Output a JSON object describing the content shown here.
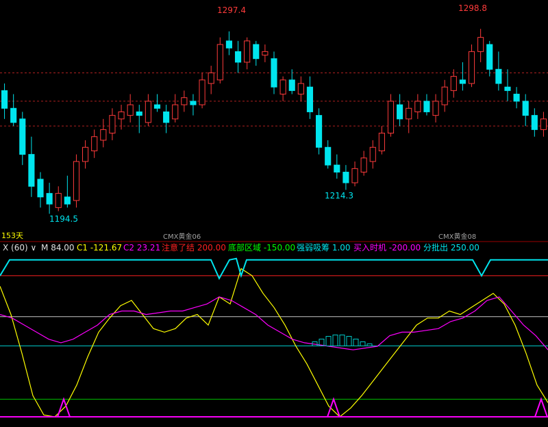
{
  "chart_data": [
    {
      "type": "candlestick",
      "title": "",
      "price_range": [
        1180,
        1312
      ],
      "colors": {
        "up": "#ff3b3b",
        "down": "#00e5ee",
        "dashed_level": "#b02020"
      },
      "dashed_levels": [
        1274,
        1258,
        1244
      ],
      "candles": [
        [
          1264,
          1268,
          1248,
          1254
        ],
        [
          1254,
          1262,
          1244,
          1246
        ],
        [
          1248,
          1252,
          1222,
          1228
        ],
        [
          1228,
          1238,
          1204,
          1210
        ],
        [
          1214,
          1218,
          1198,
          1204
        ],
        [
          1206,
          1212,
          1194.5,
          1200
        ],
        [
          1198,
          1210,
          1196,
          1206
        ],
        [
          1204,
          1216,
          1198,
          1200
        ],
        [
          1202,
          1228,
          1198,
          1224
        ],
        [
          1224,
          1236,
          1220,
          1232
        ],
        [
          1230,
          1242,
          1226,
          1238
        ],
        [
          1236,
          1248,
          1232,
          1242
        ],
        [
          1240,
          1254,
          1236,
          1250
        ],
        [
          1248,
          1256,
          1242,
          1252
        ],
        [
          1250,
          1262,
          1246,
          1256
        ],
        [
          1252,
          1256,
          1240,
          1250
        ],
        [
          1246,
          1262,
          1244,
          1258
        ],
        [
          1256,
          1262,
          1252,
          1254
        ],
        [
          1252,
          1256,
          1240,
          1246
        ],
        [
          1248,
          1262,
          1246,
          1256
        ],
        [
          1256,
          1264,
          1252,
          1260
        ],
        [
          1258,
          1262,
          1250,
          1256
        ],
        [
          1256,
          1274,
          1254,
          1270
        ],
        [
          1268,
          1278,
          1262,
          1274
        ],
        [
          1270,
          1294,
          1268,
          1290
        ],
        [
          1292,
          1297.4,
          1284,
          1288
        ],
        [
          1286,
          1292,
          1274,
          1280
        ],
        [
          1280,
          1294,
          1276,
          1292
        ],
        [
          1290,
          1292,
          1278,
          1282
        ],
        [
          1284,
          1290,
          1280,
          1286
        ],
        [
          1282,
          1286,
          1262,
          1266
        ],
        [
          1262,
          1272,
          1258,
          1270
        ],
        [
          1270,
          1276,
          1262,
          1264
        ],
        [
          1262,
          1272,
          1258,
          1268
        ],
        [
          1266,
          1272,
          1248,
          1252
        ],
        [
          1250,
          1254,
          1228,
          1232
        ],
        [
          1232,
          1236,
          1220,
          1222
        ],
        [
          1222,
          1228,
          1214.3,
          1218
        ],
        [
          1218,
          1222,
          1208,
          1212
        ],
        [
          1212,
          1224,
          1210,
          1220
        ],
        [
          1218,
          1230,
          1216,
          1226
        ],
        [
          1224,
          1236,
          1220,
          1232
        ],
        [
          1230,
          1244,
          1228,
          1240
        ],
        [
          1240,
          1262,
          1238,
          1258
        ],
        [
          1256,
          1262,
          1244,
          1248
        ],
        [
          1248,
          1258,
          1240,
          1254
        ],
        [
          1252,
          1262,
          1248,
          1258
        ],
        [
          1258,
          1262,
          1250,
          1252
        ],
        [
          1250,
          1262,
          1246,
          1258
        ],
        [
          1256,
          1270,
          1252,
          1266
        ],
        [
          1264,
          1276,
          1260,
          1272
        ],
        [
          1270,
          1280,
          1264,
          1268
        ],
        [
          1268,
          1290,
          1266,
          1286
        ],
        [
          1286,
          1298.8,
          1280,
          1294
        ],
        [
          1290,
          1292,
          1272,
          1276
        ],
        [
          1276,
          1286,
          1264,
          1268
        ],
        [
          1266,
          1276,
          1258,
          1264
        ],
        [
          1262,
          1266,
          1254,
          1258
        ],
        [
          1258,
          1262,
          1244,
          1250
        ],
        [
          1250,
          1254,
          1238,
          1242
        ],
        [
          1242,
          1252,
          1238,
          1248
        ]
      ]
    },
    {
      "type": "line",
      "colors": {
        "X": "#ffff00",
        "C2": "#ff00ff",
        "buy_signal": "#ff00ff",
        "sell_signal": "#00e5ee"
      },
      "ylim": [
        -225,
        260
      ],
      "levels": [
        {
          "value": 200,
          "color": "#ff2020"
        },
        {
          "value": 84,
          "color": "#c8c8c8"
        },
        {
          "value": 1,
          "color": "#00c8c8"
        },
        {
          "value": -150,
          "color": "#00c000"
        },
        {
          "value": -200,
          "color": "#ff00ff"
        }
      ],
      "series": [
        {
          "name": "X",
          "values": [
            170,
            90,
            -20,
            -140,
            -195,
            -200,
            -170,
            -110,
            -30,
            40,
            80,
            115,
            130,
            90,
            50,
            40,
            50,
            80,
            90,
            60,
            140,
            120,
            220,
            200,
            150,
            110,
            60,
            0,
            -50,
            -110,
            -170,
            -200,
            -175,
            -140,
            -100,
            -60,
            -20,
            20,
            60,
            80,
            80,
            100,
            90,
            110,
            130,
            150,
            120,
            60,
            -20,
            -110,
            -160
          ]
        },
        {
          "name": "C2",
          "values": [
            90,
            80,
            60,
            40,
            20,
            10,
            20,
            40,
            60,
            90,
            100,
            100,
            90,
            95,
            100,
            100,
            110,
            120,
            140,
            130,
            110,
            90,
            60,
            40,
            20,
            10,
            5,
            0,
            -5,
            -10,
            -5,
            0,
            30,
            40,
            40,
            45,
            50,
            70,
            80,
            100,
            130,
            140,
            100,
            60,
            30,
            -10
          ]
        }
      ]
    }
  ],
  "header": {
    "x_name": "X (60)",
    "m_label": "M",
    "m_value": "84.00",
    "c1_label": "C1",
    "c1_value": "-121.67",
    "c2_label": "C2",
    "c2_value": "23.21",
    "alert_label": "注意了结",
    "alert_value": "200.00",
    "bottom_label": "底部区域",
    "bottom_value": "-150.00",
    "strong_label": "强弱吸筹",
    "strong_value": "1.00",
    "buy_label": "买入时机",
    "buy_value": "-200.00",
    "sell_label": "分批出",
    "sell_value": "250.00"
  },
  "labels": {
    "high1": "1297.4",
    "high2": "1298.8",
    "low1": "1194.5",
    "low2": "1214.3",
    "days": "153天",
    "contract1": "CMX黄金06",
    "contract2": "CMX黄金08"
  },
  "colors": {
    "up": "#ff3b3b",
    "down": "#00e5ee",
    "yellow": "#ffff00",
    "magenta": "#ff00ff",
    "white": "#e0e0e0",
    "green": "#00ff00",
    "red": "#ff2020",
    "cyan": "#00e5ee",
    "grey": "#a0a0a0"
  }
}
